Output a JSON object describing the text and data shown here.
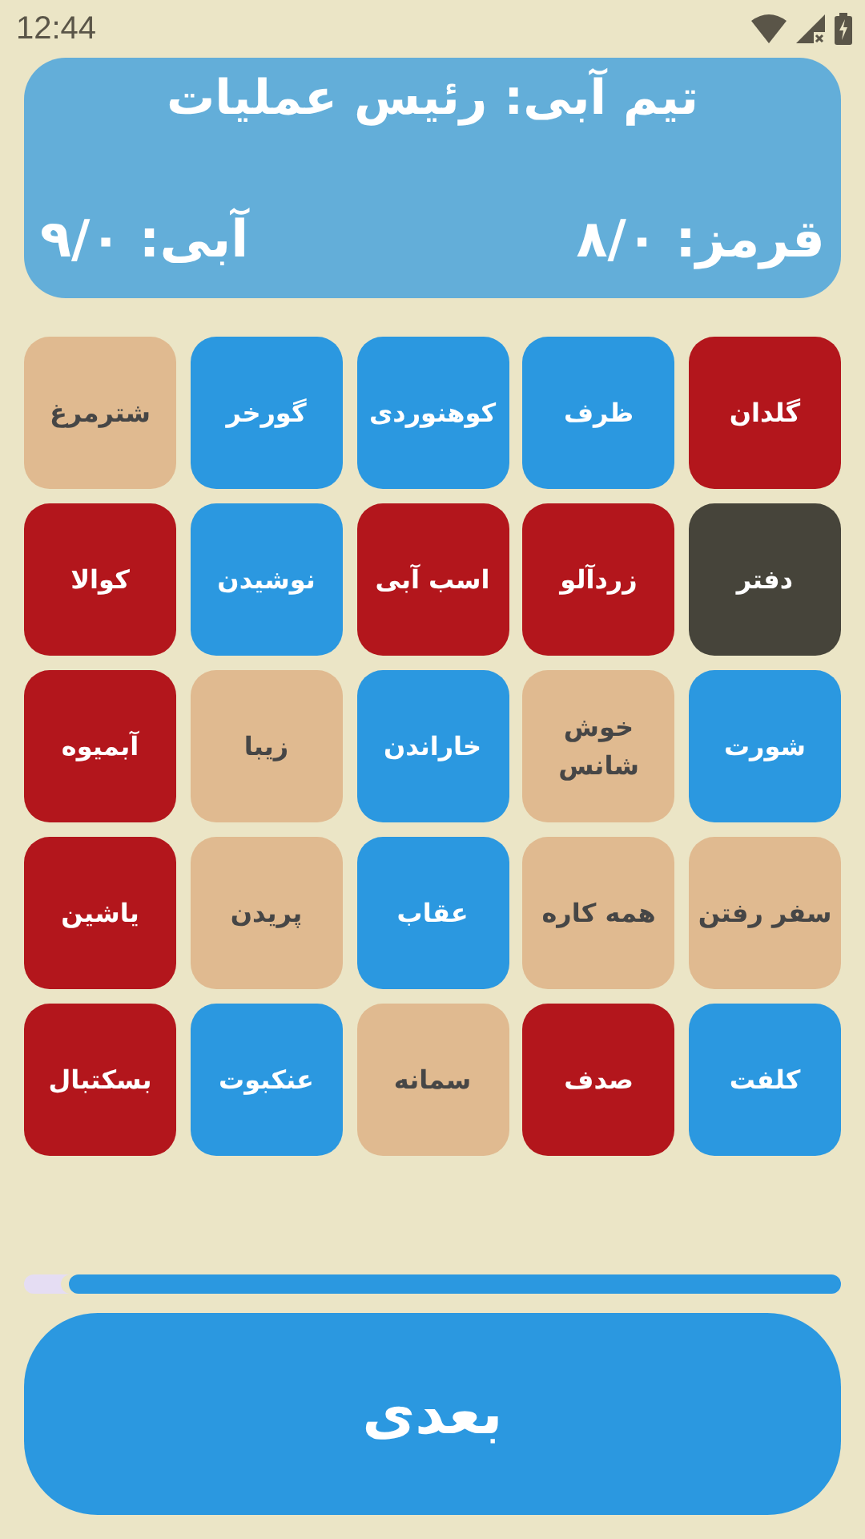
{
  "status_bar": {
    "time": "12:44"
  },
  "header": {
    "title": "تیم آبی: رئیس عملیات",
    "scores": [
      {
        "text": "قرمز: ۸/۰"
      },
      {
        "text": "آبی: ۹/۰"
      }
    ]
  },
  "cards": [
    {
      "word": "گلدان",
      "kind": "red"
    },
    {
      "word": "ظرف",
      "kind": "blue"
    },
    {
      "word": "کوهنوردی",
      "kind": "blue"
    },
    {
      "word": "گورخر",
      "kind": "blue"
    },
    {
      "word": "شترمرغ",
      "kind": "neutral"
    },
    {
      "word": "دفتر",
      "kind": "assassin"
    },
    {
      "word": "زردآلو",
      "kind": "red"
    },
    {
      "word": "اسب آبی",
      "kind": "red"
    },
    {
      "word": "نوشیدن",
      "kind": "blue"
    },
    {
      "word": "کوالا",
      "kind": "red"
    },
    {
      "word": "شورت",
      "kind": "blue"
    },
    {
      "word": "خوش شانس",
      "kind": "neutral"
    },
    {
      "word": "خاراندن",
      "kind": "blue"
    },
    {
      "word": "زیبا",
      "kind": "neutral"
    },
    {
      "word": "آبمیوه",
      "kind": "red"
    },
    {
      "word": "سفر رفتن",
      "kind": "neutral"
    },
    {
      "word": "همه کاره",
      "kind": "neutral"
    },
    {
      "word": "عقاب",
      "kind": "blue"
    },
    {
      "word": "پریدن",
      "kind": "neutral"
    },
    {
      "word": "یاشین",
      "kind": "red"
    },
    {
      "word": "کلفت",
      "kind": "blue"
    },
    {
      "word": "صدف",
      "kind": "red"
    },
    {
      "word": "سمانه",
      "kind": "neutral"
    },
    {
      "word": "عنکبوت",
      "kind": "blue"
    },
    {
      "word": "بسکتبال",
      "kind": "red"
    }
  ],
  "timer": {
    "level": 0.945
  },
  "next_button": {
    "label": "بعدی"
  }
}
